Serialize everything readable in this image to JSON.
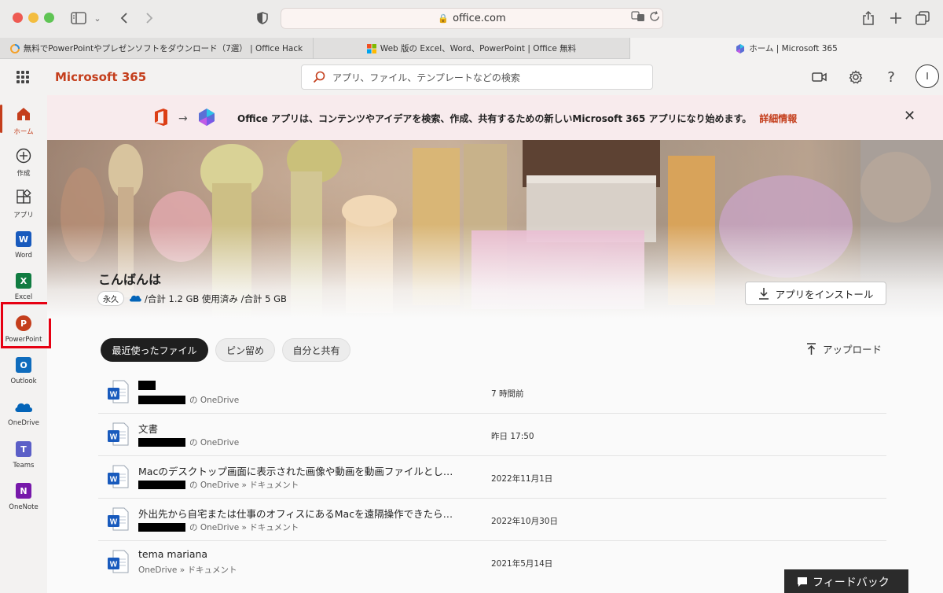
{
  "browser": {
    "url": "office.com",
    "tabs": [
      {
        "title": "無料でPowerPointやプレゼンソフトをダウンロード（7選） | Office Hack"
      },
      {
        "title": "Web 版の Excel、Word、PowerPoint | Office 無料"
      },
      {
        "title": "ホーム | Microsoft 365"
      }
    ]
  },
  "header": {
    "brand": "Microsoft 365",
    "search_placeholder": "アプリ、ファイル、テンプレートなどの検索",
    "avatar_initial": "I"
  },
  "rail": [
    {
      "label": "ホーム",
      "icon": "home-icon"
    },
    {
      "label": "作成",
      "icon": "create-icon"
    },
    {
      "label": "アプリ",
      "icon": "apps-icon"
    },
    {
      "label": "Word",
      "icon": "word-icon"
    },
    {
      "label": "Excel",
      "icon": "excel-icon"
    },
    {
      "label": "PowerPoint",
      "icon": "powerpoint-icon"
    },
    {
      "label": "Outlook",
      "icon": "outlook-icon"
    },
    {
      "label": "OneDrive",
      "icon": "onedrive-icon"
    },
    {
      "label": "Teams",
      "icon": "teams-icon"
    },
    {
      "label": "OneNote",
      "icon": "onenote-icon"
    }
  ],
  "banner": {
    "message": "Office アプリは、コンテンツやアイデアを検索、作成、共有するための新しいMicrosoft 365 アプリになり始めます。",
    "link": "詳細情報"
  },
  "hero": {
    "greeting": "こんばんは",
    "license_badge": "永久",
    "storage_text": "/合計 1.2 GB 使用済み /合計 5 GB",
    "install_label": "アプリをインストール"
  },
  "file_tabs": [
    {
      "label": "最近使ったファイル"
    },
    {
      "label": "ピン留め"
    },
    {
      "label": "自分と共有"
    }
  ],
  "upload_label": "アップロード",
  "files": [
    {
      "name": "",
      "location": "の OneDrive",
      "date": "7 時間前"
    },
    {
      "name": "文書",
      "location": "の OneDrive",
      "date": "昨日 17:50"
    },
    {
      "name": "Macのデスクトップ画面に表示された画像や動画を動画ファイルとし…",
      "location": "の OneDrive » ドキュメント",
      "date": "2022年11月1日"
    },
    {
      "name": "外出先から自宅または仕事のオフィスにあるMacを遠隔操作できたら…",
      "location": "の OneDrive » ドキュメント",
      "date": "2022年10月30日"
    },
    {
      "name": "tema mariana",
      "location": "OneDrive » ドキュメント",
      "date": "2021年5月14日"
    }
  ],
  "feedback_label": "フィードバック",
  "colors": {
    "accent": "#c43e1c",
    "highlight_box": "#e60012",
    "word": "#185abd",
    "excel": "#107c41",
    "powerpoint": "#c43e1c",
    "outlook": "#0f6cbd",
    "onedrive": "#0364b8",
    "teams": "#5b5fc7",
    "onenote": "#7719aa"
  }
}
